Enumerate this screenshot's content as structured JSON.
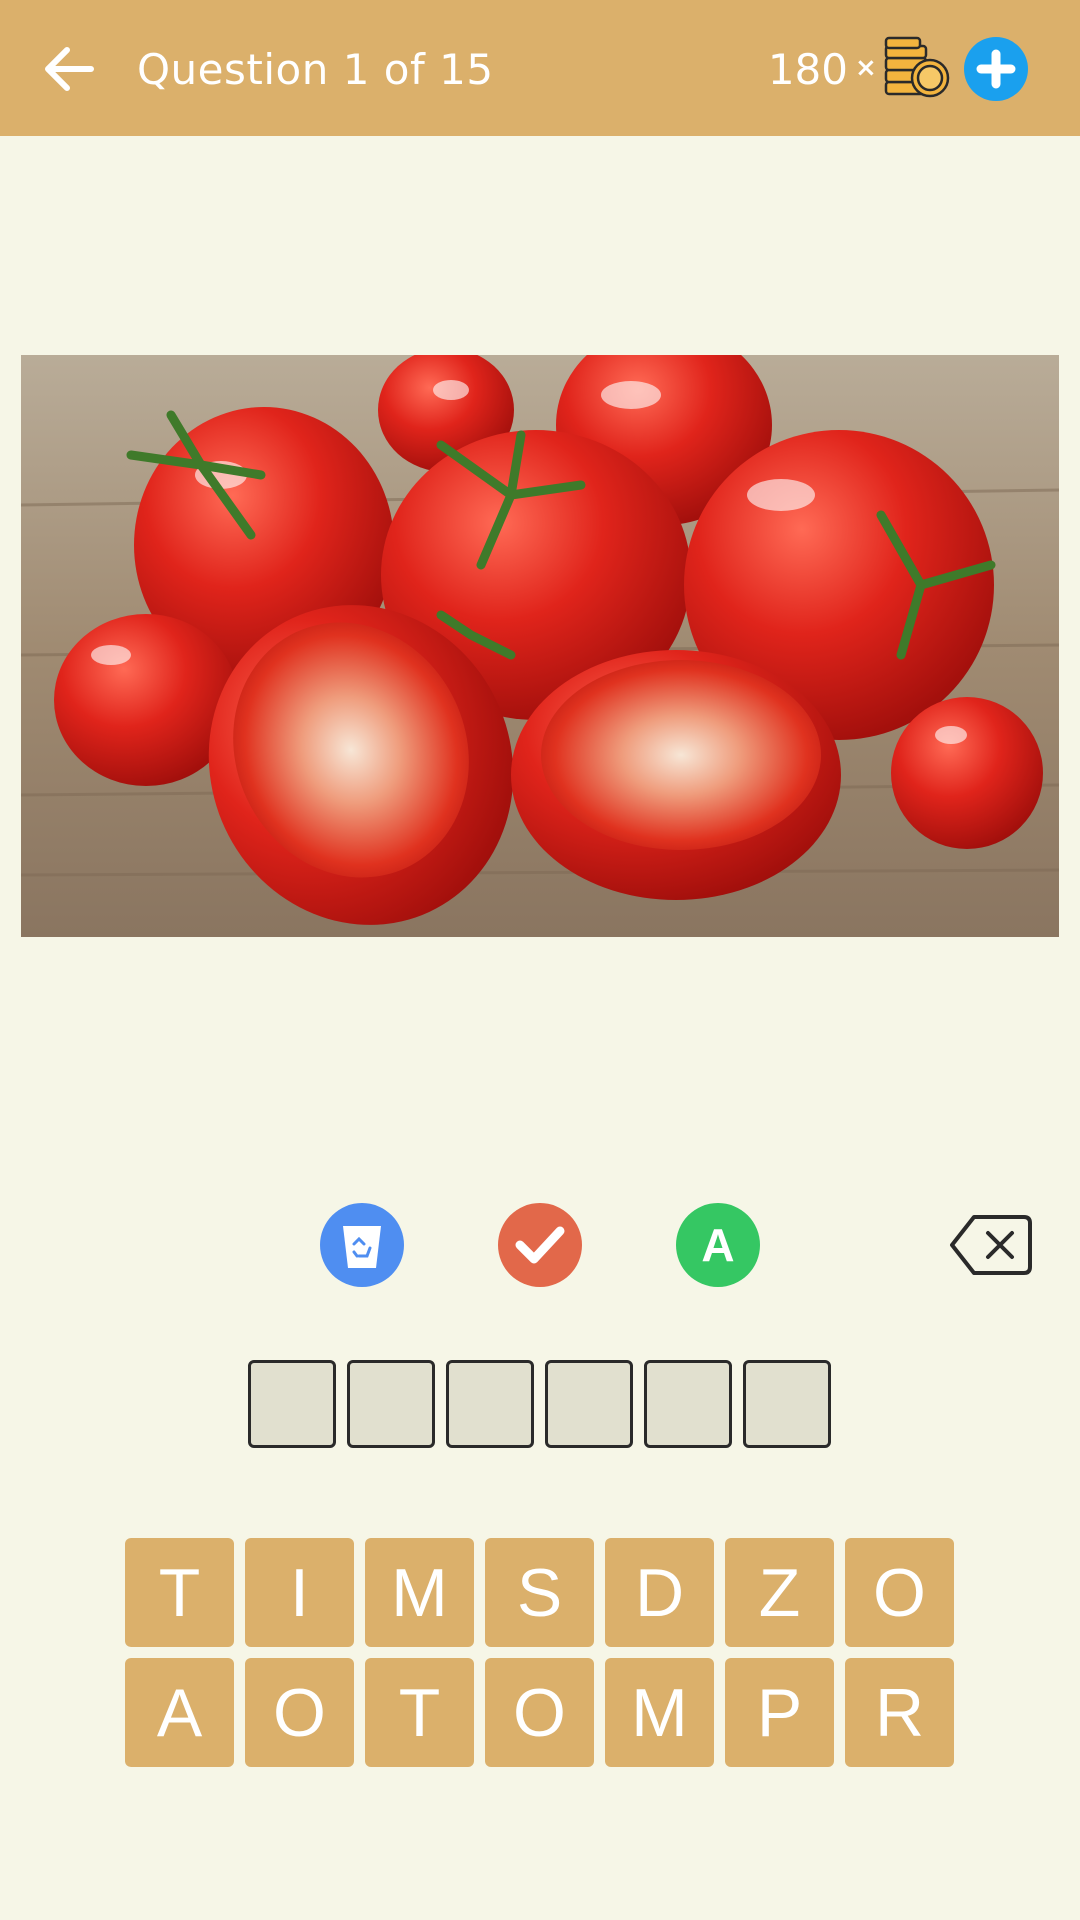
{
  "header": {
    "title": "Question 1 of 15",
    "coins": "180",
    "times_sign": "×",
    "icons": {
      "back": "back-arrow-icon",
      "coins": "coin-stack-icon",
      "add": "plus-icon"
    }
  },
  "question_image": {
    "subject": "tomatoes-photo"
  },
  "tools": {
    "icons": [
      "recycle-bin-icon",
      "checkmark-icon",
      "letter-reveal-icon",
      "backspace-icon"
    ],
    "reveal_letter": "A"
  },
  "answer_slots": [
    "",
    "",
    "",
    "",
    "",
    ""
  ],
  "keyboard": {
    "rows": [
      [
        "T",
        "I",
        "M",
        "S",
        "D",
        "Z",
        "O"
      ],
      [
        "A",
        "O",
        "T",
        "O",
        "M",
        "P",
        "R"
      ]
    ]
  },
  "colors": {
    "header_bg": "#dbb06b",
    "page_bg": "#f6f6e7",
    "key_bg": "#dbb06b",
    "slot_bg": "#e1e0cf",
    "remove_tool": "#4f8ef1",
    "check_tool": "#e2684a",
    "reveal_tool": "#35c763",
    "add_button": "#1aa0ee"
  }
}
